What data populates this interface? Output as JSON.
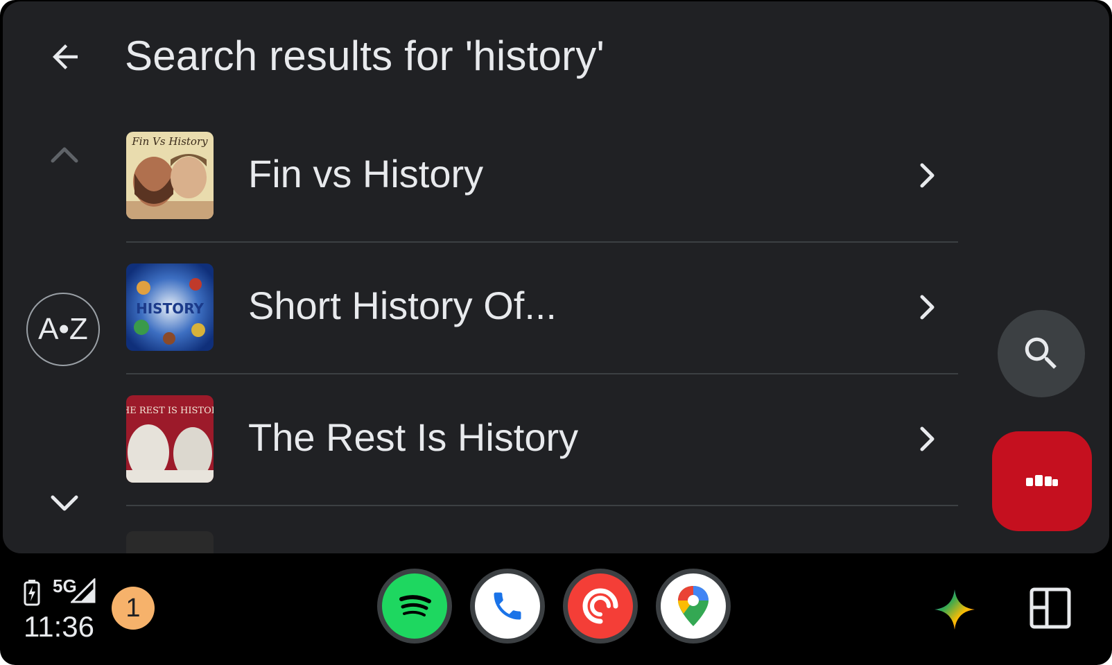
{
  "header": {
    "title": "Search results for 'history'"
  },
  "az_label": "A•Z",
  "results": [
    {
      "label": "Fin vs History",
      "thumb_text": "Fin Vs History"
    },
    {
      "label": "Short History Of...",
      "thumb_text": "HISTORY"
    },
    {
      "label": "The Rest Is History",
      "thumb_text": "THE REST IS HISTORY"
    }
  ],
  "status_bar": {
    "network": "5G",
    "time": "11:36",
    "notification_count": "1"
  },
  "dock": [
    {
      "name": "spotify",
      "icon": "spotify-icon"
    },
    {
      "name": "phone",
      "icon": "phone-icon"
    },
    {
      "name": "pocket-casts",
      "icon": "pocket-casts-icon"
    },
    {
      "name": "maps",
      "icon": "maps-icon"
    }
  ],
  "colors": {
    "background": "#202124",
    "text": "#e8eaed",
    "now_playing": "#c5101f",
    "notification": "#f6b26b"
  }
}
